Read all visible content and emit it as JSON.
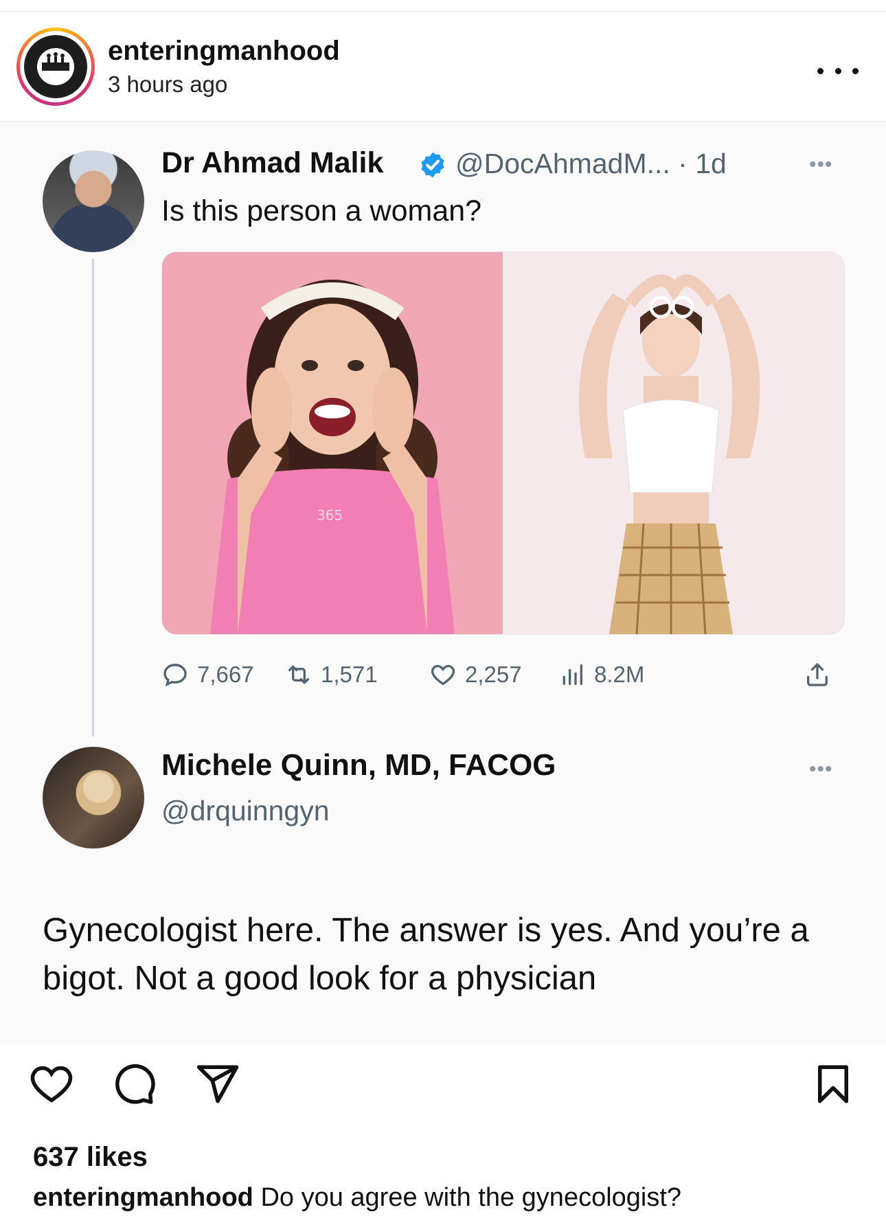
{
  "post_header": {
    "username": "enteringmanhood",
    "time_ago": "3 hours ago",
    "more_icon": "more-horizontal-icon"
  },
  "tweet": {
    "author_name": "Dr Ahmad Malik",
    "handle_and_time": "@DocAhmadM... · 1d",
    "text": "Is this person a woman?",
    "stats": {
      "replies": "7,667",
      "retweets": "1,571",
      "likes": "2,257",
      "views": "8.2M"
    }
  },
  "reply": {
    "author_name": "Michele Quinn, MD, FACOG",
    "handle": "@drquinngyn",
    "text": "Gynecologist here. The answer is yes. And you’re a bigot. Not a good look for a physician"
  },
  "post_footer": {
    "likes_count": "637 likes",
    "caption_user": "enteringmanhood",
    "caption_text": "Do you agree with the gynecologist?"
  },
  "colors": {
    "secondary_text": "#536471",
    "verified_blue": "#1d9bf0",
    "pink_background": "#f1a8b6"
  }
}
